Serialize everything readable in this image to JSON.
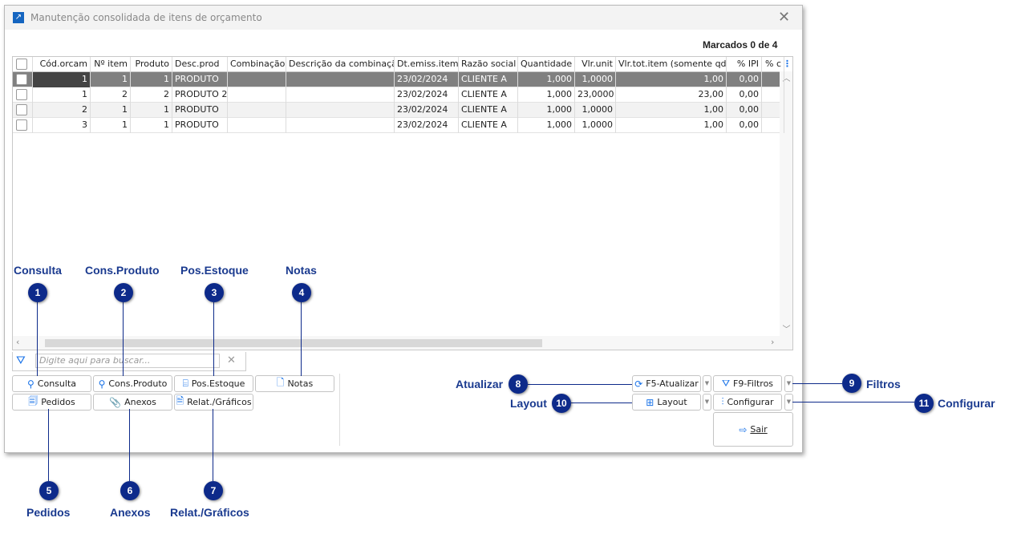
{
  "window": {
    "title": "Manutenção consolidada de itens de orçamento",
    "marked": "Marcados 0 de 4"
  },
  "grid": {
    "columns": [
      "Cód.orcam",
      "Nº item",
      "Produto",
      "Desc.prod",
      "Combinação",
      "Descrição da combinação",
      "Dt.emiss.item",
      "Razão social",
      "Quantidade",
      "Vlr.unit",
      "Vlr.tot.item (somente qdo",
      "% IPI",
      "% c"
    ],
    "rows": [
      [
        "1",
        "1",
        "1",
        "PRODUTO",
        "",
        "",
        "23/02/2024",
        "CLIENTE A",
        "1,000",
        "1,0000",
        "1,00",
        "0,00",
        ""
      ],
      [
        "1",
        "2",
        "2",
        "PRODUTO 2",
        "",
        "",
        "23/02/2024",
        "CLIENTE A",
        "1,000",
        "23,0000",
        "23,00",
        "0,00",
        ""
      ],
      [
        "2",
        "1",
        "1",
        "PRODUTO",
        "",
        "",
        "23/02/2024",
        "CLIENTE A",
        "1,000",
        "1,0000",
        "1,00",
        "0,00",
        ""
      ],
      [
        "3",
        "1",
        "1",
        "PRODUTO",
        "",
        "",
        "23/02/2024",
        "CLIENTE A",
        "1,000",
        "1,0000",
        "1,00",
        "0,00",
        ""
      ]
    ]
  },
  "search": {
    "placeholder": "Digite aqui para buscar..."
  },
  "buttons": {
    "consulta": "Consulta",
    "cons_produto": "Cons.Produto",
    "pos_estoque": "Pos.Estoque",
    "notas": "Notas",
    "pedidos": "Pedidos",
    "anexos": "Anexos",
    "relat": "Relat./Gráficos",
    "atualizar": "F5-Atualizar",
    "filtros": "F9-Filtros",
    "layout": "Layout",
    "configurar": "Configurar",
    "sair": "Sair"
  },
  "callouts": [
    {
      "n": "1",
      "label": "Consulta"
    },
    {
      "n": "2",
      "label": "Cons.Produto"
    },
    {
      "n": "3",
      "label": "Pos.Estoque"
    },
    {
      "n": "4",
      "label": "Notas"
    },
    {
      "n": "5",
      "label": "Pedidos"
    },
    {
      "n": "6",
      "label": "Anexos"
    },
    {
      "n": "7",
      "label": "Relat./Gráficos"
    },
    {
      "n": "8",
      "label": "Atualizar"
    },
    {
      "n": "9",
      "label": "Filtros"
    },
    {
      "n": "10",
      "label": "Layout"
    },
    {
      "n": "11",
      "label": "Configurar"
    }
  ],
  "colors": {
    "accent": "#1a73e8",
    "callout": "#0d2a8a",
    "selected_row": "#808080"
  }
}
